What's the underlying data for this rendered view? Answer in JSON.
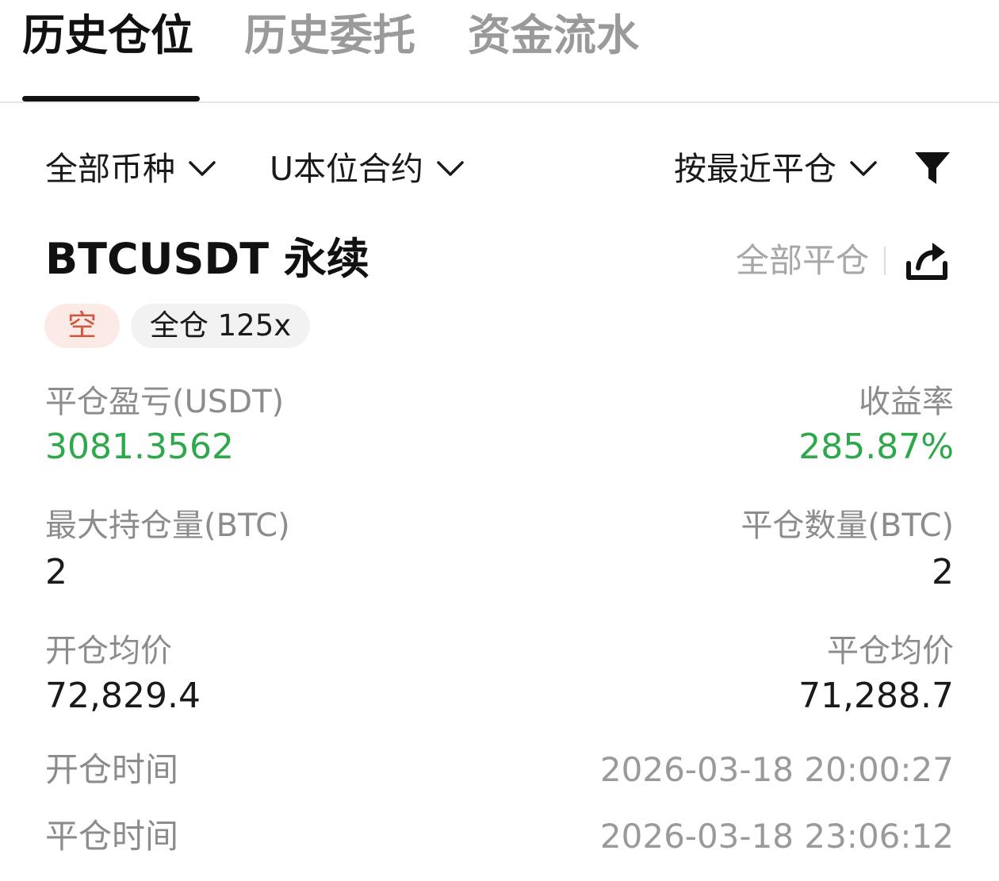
{
  "tabs": [
    {
      "label": "历史仓位",
      "active": true
    },
    {
      "label": "历史委托",
      "active": false
    },
    {
      "label": "资金流水",
      "active": false
    }
  ],
  "filters": {
    "coin": "全部币种",
    "contract": "U本位合约",
    "sort": "按最近平仓",
    "funnel_icon": "filter-icon"
  },
  "position": {
    "symbol": "BTCUSDT 永续",
    "close_all_label": "全部平仓",
    "share_icon": "share-icon",
    "side_tag": "空",
    "margin_tag": "全仓 125x",
    "colors": {
      "profit": "#2ea84a",
      "short": "#d4553b",
      "short_bg": "#fbeae6"
    },
    "pnl_label": "平仓盈亏(USDT)",
    "pnl_value": "3081.3562",
    "roi_label": "收益率",
    "roi_value": "285.87%",
    "max_size_label": "最大持仓量(BTC)",
    "max_size_value": "2",
    "close_qty_label": "平仓数量(BTC)",
    "close_qty_value": "2",
    "open_price_label": "开仓均价",
    "open_price_value": "72,829.4",
    "close_price_label": "平仓均价",
    "close_price_value": "71,288.7",
    "open_time_label": "开仓时间",
    "open_time_value": "2026-03-18 20:00:27",
    "close_time_label": "平仓时间",
    "close_time_value": "2026-03-18 23:06:12"
  }
}
